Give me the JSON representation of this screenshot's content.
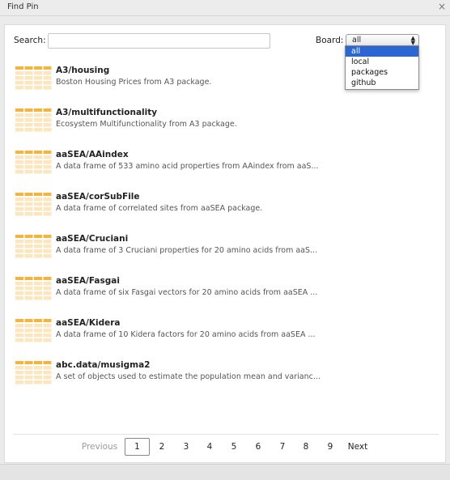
{
  "window": {
    "title": "Find Pin",
    "close_glyph": "×"
  },
  "search": {
    "label": "Search:",
    "value": "",
    "placeholder": ""
  },
  "board": {
    "label": "Board:",
    "selected": "all",
    "options": [
      "all",
      "local",
      "packages",
      "github"
    ]
  },
  "pins": [
    {
      "name": "A3/housing",
      "description": "Boston Housing Prices from A3 package."
    },
    {
      "name": "A3/multifunctionality",
      "description": "Ecosystem Multifunctionality from A3 package."
    },
    {
      "name": "aaSEA/AAindex",
      "description": "A data frame of 533 amino acid properties from AAindex from aaS..."
    },
    {
      "name": "aaSEA/corSubFile",
      "description": "A data frame of correlated sites from aaSEA package."
    },
    {
      "name": "aaSEA/Cruciani",
      "description": "A data frame of 3 Cruciani properties for 20 amino acids from aaS..."
    },
    {
      "name": "aaSEA/Fasgai",
      "description": "A data frame of six Fasgai vectors for 20 amino acids from aaSEA ..."
    },
    {
      "name": "aaSEA/Kidera",
      "description": "A data frame of 10 Kidera factors for 20 amino acids from aaSEA ..."
    },
    {
      "name": "abc.data/musigma2",
      "description": "A set of objects used to estimate the population mean and varianc..."
    }
  ],
  "pagination": {
    "previous": "Previous",
    "pages": [
      "1",
      "2",
      "3",
      "4",
      "5",
      "6",
      "7",
      "8",
      "9"
    ],
    "current": "1",
    "next": "Next"
  },
  "colors": {
    "icon_accent": "#f5b43c",
    "icon_light": "#fbe6bd",
    "selection": "#2a67d2"
  }
}
